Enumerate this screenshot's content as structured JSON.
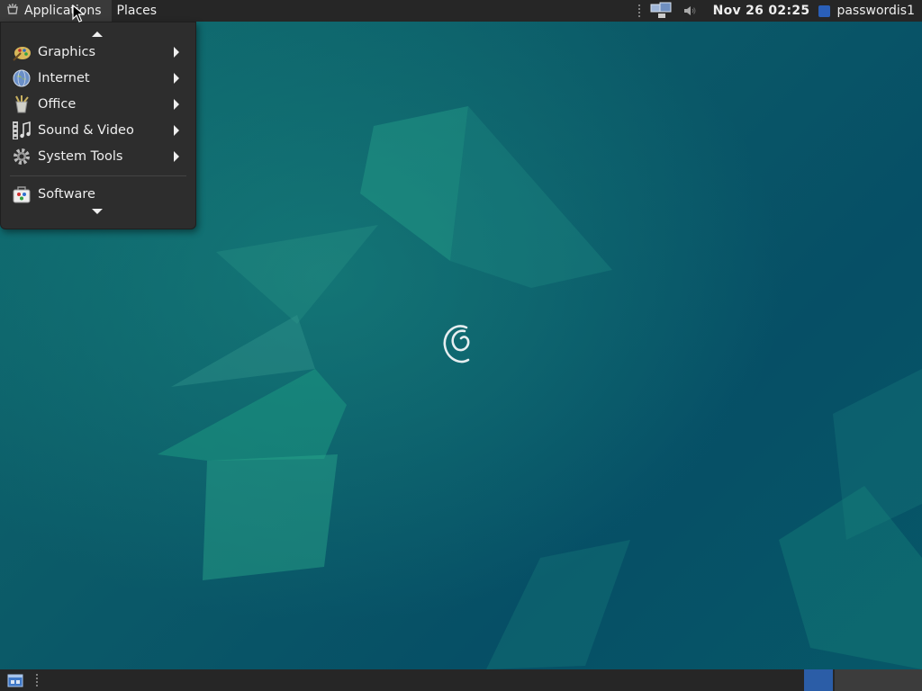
{
  "top_panel": {
    "applications_label": "Applications",
    "places_label": "Places",
    "clock": "Nov 26 02:25",
    "username": "passwordis1"
  },
  "apps_menu": {
    "items": [
      {
        "label": "Graphics",
        "icon": "graphics-icon",
        "has_submenu": true
      },
      {
        "label": "Internet",
        "icon": "internet-icon",
        "has_submenu": true
      },
      {
        "label": "Office",
        "icon": "office-icon",
        "has_submenu": true
      },
      {
        "label": "Sound & Video",
        "icon": "sound-video-icon",
        "has_submenu": true
      },
      {
        "label": "System Tools",
        "icon": "system-tools-icon",
        "has_submenu": true
      },
      {
        "label": "Software",
        "icon": "software-icon",
        "has_submenu": false
      }
    ]
  },
  "colors": {
    "panel_bg": "#262626",
    "menu_bg": "#2d2d2d",
    "workspace_active": "#2b5da7",
    "user_indicator": "#2a5fb8"
  },
  "bottom_panel": {
    "workspaces": [
      {
        "active": true
      },
      {
        "active": false
      }
    ]
  }
}
